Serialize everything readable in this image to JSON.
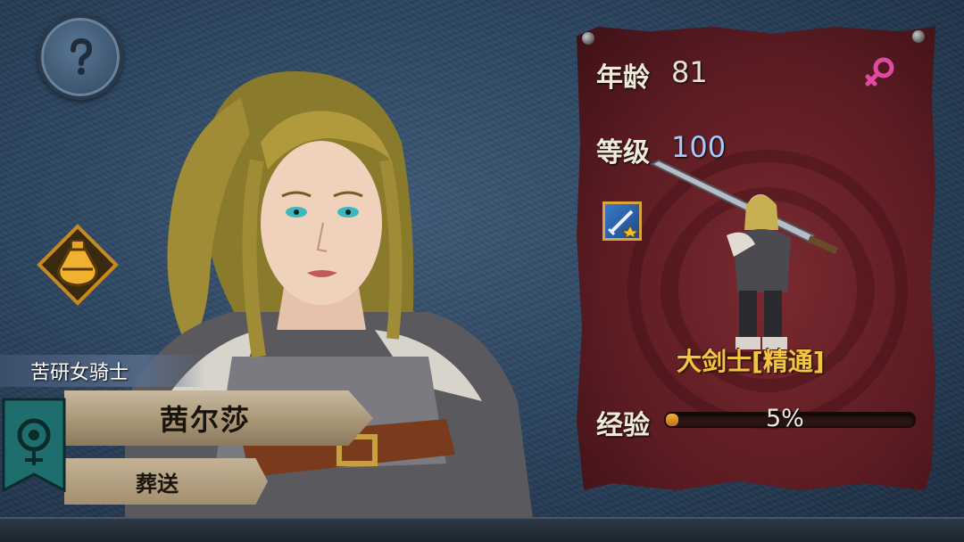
{
  "character": {
    "title": "苦研女骑士",
    "name": "茜尔莎",
    "trait": "葬送"
  },
  "stats": {
    "age_label": "年龄",
    "age_value": "81",
    "level_label": "等级",
    "level_value": "100",
    "class_name": "大剑士[精通]",
    "xp_label": "经验",
    "xp_text": "5%",
    "xp_fraction": 0.05
  },
  "icons": {
    "help": "question-mark-icon",
    "potion": "potion-flask-icon",
    "gender": "female-symbol-icon",
    "skill": "sword-skill-icon",
    "class_banner": "class-banner-icon"
  },
  "colors": {
    "level_value": "#a8c8ff",
    "age_value": "#e8e2d0",
    "gender": "#e04aa0",
    "class_name": "#f4c444"
  }
}
